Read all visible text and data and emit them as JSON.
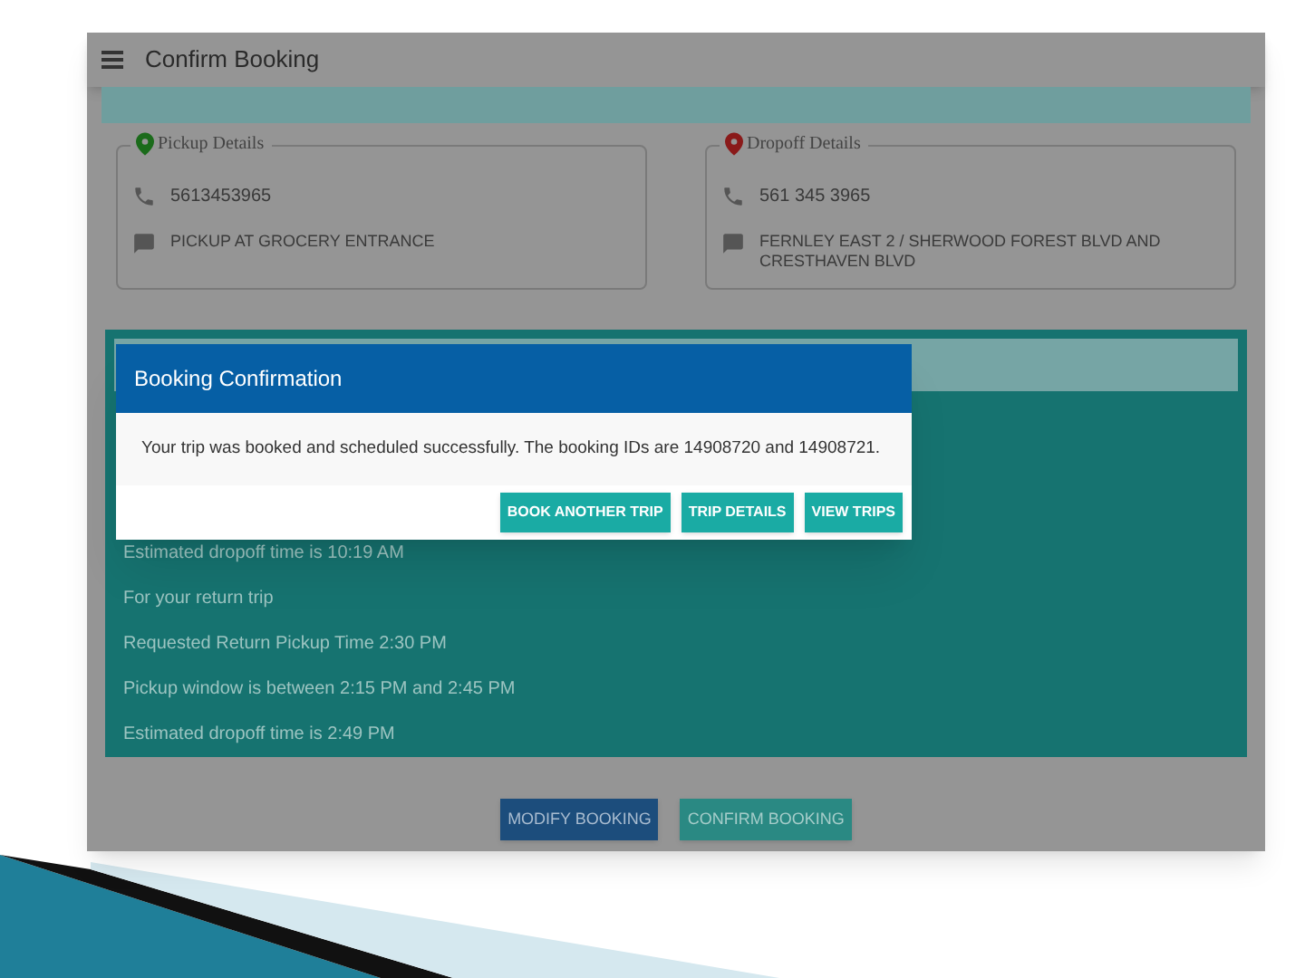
{
  "app_bar": {
    "title": "Confirm Booking"
  },
  "pickup": {
    "legend": "Pickup Details",
    "phone": "5613453965",
    "note": "PICKUP AT GROCERY ENTRANCE"
  },
  "dropoff": {
    "legend": "Dropoff Details",
    "phone": "561 345 3965",
    "note": "FERNLEY EAST 2 / SHERWOOD FOREST BLVD AND CRESTHAVEN BLVD"
  },
  "summary_lines": [
    "Estimated dropoff time is 10:19 AM",
    "For your return trip",
    "Requested Return Pickup Time 2:30 PM",
    "Pickup window is between 2:15 PM and 2:45 PM",
    "Estimated dropoff time is 2:49 PM"
  ],
  "footer_buttons": [
    {
      "label": "MODIFY BOOKING",
      "kind": "primary"
    },
    {
      "label": "CONFIRM BOOKING",
      "kind": "secondary"
    }
  ],
  "dialog": {
    "title": "Booking Confirmation",
    "message": "Your trip was booked and scheduled successfully. The booking IDs are 14908720 and 14908721.",
    "buttons": [
      "BOOK ANOTHER TRIP",
      "TRIP DETAILS",
      "VIEW TRIPS"
    ]
  }
}
